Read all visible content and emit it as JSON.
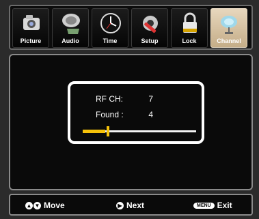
{
  "tabs": [
    {
      "label": "Picture",
      "icon": "camera-icon",
      "active": false
    },
    {
      "label": "Audio",
      "icon": "speaker-icon",
      "active": false
    },
    {
      "label": "Time",
      "icon": "clock-icon",
      "active": false
    },
    {
      "label": "Setup",
      "icon": "gear-tools-icon",
      "active": false
    },
    {
      "label": "Lock",
      "icon": "padlock-icon",
      "active": false
    },
    {
      "label": "Channel",
      "icon": "satellite-dish-icon",
      "active": true
    }
  ],
  "scan": {
    "rf_ch_label": "RF CH:",
    "rf_ch_value": "7",
    "found_label": "Found :",
    "found_value": "4",
    "progress_fraction": 0.2
  },
  "footer": {
    "move_label": "Move",
    "next_label": "Next",
    "menu_key": "MENU",
    "exit_label": "Exit"
  },
  "colors": {
    "accent": "#f6c20a",
    "active_tab": "#d9c6a6",
    "panel_border": "#8a8a8a"
  }
}
